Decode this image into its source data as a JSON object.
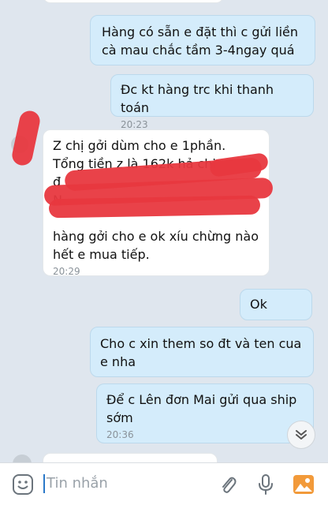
{
  "messages": [
    {
      "direction": "out",
      "text_lines": [
        "Hàng có sẵn e đặt thì c gửi liền",
        "cà mau chắc tầm 3-4ngay quá"
      ]
    },
    {
      "direction": "out",
      "text": "Đc kt hàng trc khi thanh toán",
      "time": "20:23"
    },
    {
      "direction": "in",
      "text_lines": [
        "Z chị gởi dùm cho e 1phần.",
        "Tổng tiền z là 162k hả chị.",
        "đ",
        "N",
        "",
        "hàng gởi cho e ok xíu chừng nào",
        "hết e mua tiếp."
      ],
      "time": "20:29",
      "redacted": true
    },
    {
      "direction": "out",
      "text": "Ok"
    },
    {
      "direction": "out",
      "text_lines": [
        "Cho c xin them so đt và ten cua",
        "e nha"
      ]
    },
    {
      "direction": "out",
      "text_lines": [
        "Để c Lên đơn Mai gửi qua ship",
        "sớm"
      ],
      "time": "20:36"
    }
  ],
  "composer": {
    "placeholder": "Tin nhắn",
    "icons": [
      "emoji-icon",
      "attach-icon",
      "microphone-icon",
      "image-icon"
    ]
  },
  "scroll_button_icon": "double-chevron-down-icon",
  "colors": {
    "background": "#dfe6ee",
    "outgoing_bubble": "#d4ecfb",
    "incoming_bubble": "#ffffff",
    "redaction": "#e8383f",
    "accent": "#2a78c8"
  }
}
